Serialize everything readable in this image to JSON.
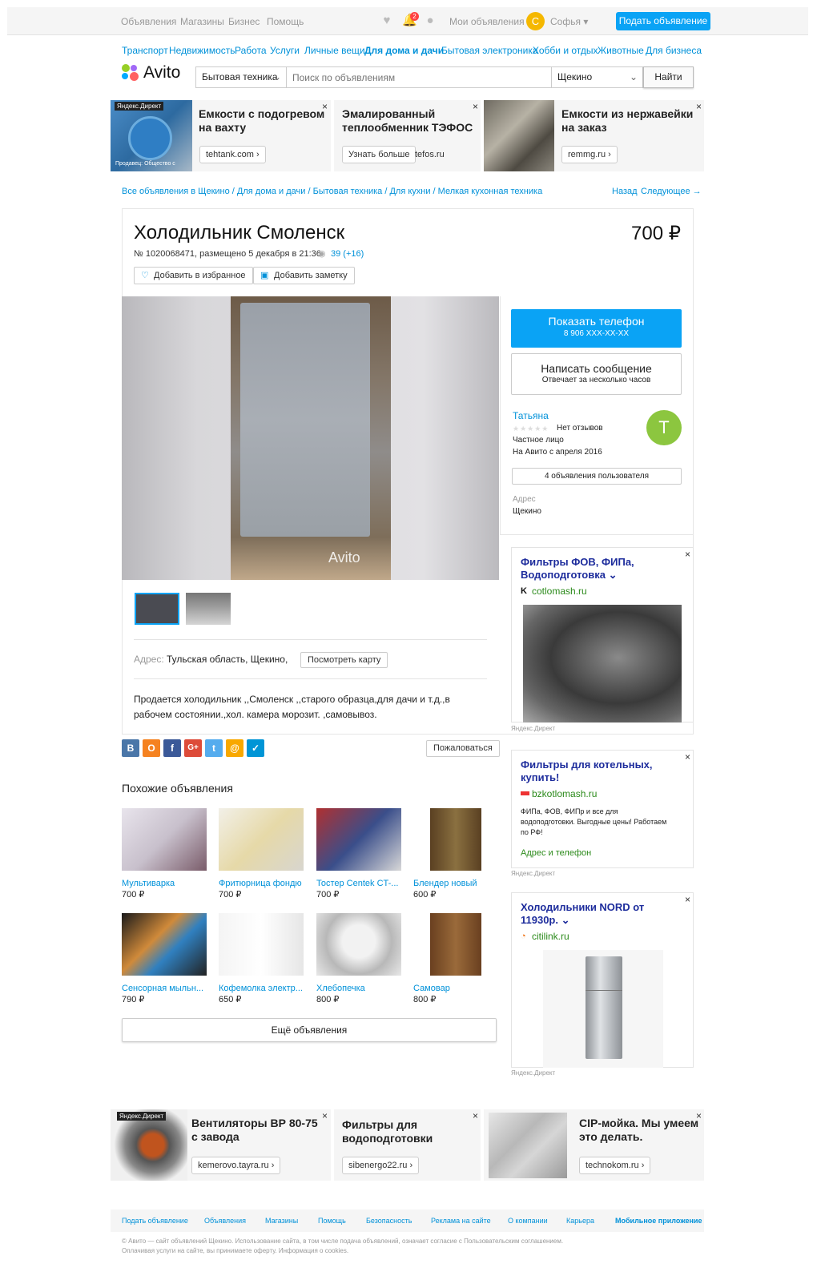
{
  "topbar": {
    "links": [
      "Объявления",
      "Магазины",
      "Бизнес",
      "Помощь"
    ],
    "notif_count": "2",
    "my_ads": "Мои объявления",
    "avatar_letter": "С",
    "user": "Софья",
    "post_ad": "Подать объявление"
  },
  "categories": [
    "Транспорт",
    "Недвижимость",
    "Работа",
    "Услуги",
    "Личные вещи",
    "Для дома и дачи",
    "Бытовая электроника",
    "Хобби и отдых",
    "Животные",
    "Для бизнеса"
  ],
  "logo": "Avito",
  "search": {
    "category": "Бытовая техника",
    "placeholder": "Поиск по объявлениям",
    "city": "Щекино",
    "button": "Найти"
  },
  "top_ads": [
    {
      "badge": "Яндекс.Директ",
      "caption": "Продавец: Общество с",
      "title": "Емкости с подогревом на вахту",
      "button": "tehtank.com ›"
    },
    {
      "title": "Эмалированный теплообменник ТЭФОС",
      "button": "Узнать больше",
      "domain": "tefos.ru"
    },
    {
      "title": "Емкости из нержавейки на заказ",
      "button": "remmg.ru ›"
    }
  ],
  "breadcrumbs": "Все объявления в Щекино / Для дома и дачи / Бытовая техника / Для кухни / Мелкая кухонная техника",
  "nav": {
    "back": "Назад",
    "next": "Следующее →"
  },
  "item": {
    "title": "Холодильник Смоленск",
    "price": "700 ₽",
    "meta": "№ 1020068471, размещено 5 декабря в 21:36",
    "views": "39 (+16)",
    "fav": "Добавить в избранное",
    "note": "Добавить заметку",
    "watermark": "Avito",
    "address_label": "Адрес:",
    "address": "Тульская область, Щекино,",
    "map_btn": "Посмотреть карту",
    "description": "Продается холодильник ,,Смоленск ,,старого образца,для дачи и т.д.,в рабочем состоянии.,хол. камера морозит. ,самовывоз.",
    "complain": "Пожаловаться"
  },
  "seller": {
    "phone_btn": "Показать телефон",
    "phone": "8 906 XXX-XX-XX",
    "msg_btn": "Написать сообщение",
    "msg_sub": "Отвечает за несколько часов",
    "name": "Татьяна",
    "reviews": "Нет отзывов",
    "type": "Частное лицо",
    "since": "На Авито с апреля 2016",
    "avatar": "Т",
    "ads_count": "4 объявления пользователя",
    "addr_label": "Адрес",
    "addr": "Щекино"
  },
  "social": [
    "В",
    "О",
    "f",
    "G+",
    "t",
    "@",
    "✓"
  ],
  "similar_title": "Похожие объявления",
  "similar": [
    {
      "title": "Мультиварка",
      "price": "700 ₽"
    },
    {
      "title": "Фритюрница фондю",
      "price": "700 ₽"
    },
    {
      "title": "Тостер Centek CT-...",
      "price": "700 ₽"
    },
    {
      "title": "Блендер новый",
      "price": "600 ₽"
    },
    {
      "title": "Сенсорная мыльн...",
      "price": "790 ₽"
    },
    {
      "title": "Кофемолка электр...",
      "price": "650 ₽"
    },
    {
      "title": "Хлебопечка",
      "price": "800 ₽"
    },
    {
      "title": "Самовар",
      "price": "800 ₽"
    }
  ],
  "more_btn": "Ещё объявления",
  "right_ads": [
    {
      "title": "Фильтры ФОВ, ФИПа, Водоподготовка",
      "domain": "cotlomash.ru",
      "label": "Яндекс.Директ"
    },
    {
      "title": "Фильтры для котельных, купить!",
      "domain": "bzkotlomash.ru",
      "text": "ФИПа, ФОВ, ФИПр и все для водоподготовки. Выгодные цены! Работаем по РФ!",
      "link": "Адрес и телефон",
      "label": "Яндекс.Директ"
    },
    {
      "title": "Холодильники NORD от 11930р.",
      "domain": "citilink.ru",
      "label": "Яндекс.Директ"
    }
  ],
  "bottom_ads": [
    {
      "badge": "Яндекс.Директ",
      "title": "Вентиляторы ВР 80-75 с завода",
      "button": "kemerovo.tayra.ru ›"
    },
    {
      "title": "Фильтры для водоподготовки",
      "button": "sibenergo22.ru ›"
    },
    {
      "title": "CIP-мойка. Мы умеем это делать.",
      "button": "technokom.ru ›"
    }
  ],
  "footer": {
    "links": [
      "Подать объявление",
      "Объявления",
      "Магазины",
      "Помощь",
      "Безопасность",
      "Реклама на сайте",
      "О компании",
      "Карьера",
      "Мобильное приложение"
    ],
    "line1": "© Авито — сайт объявлений Щекино. Использование сайта, в том числе подача объявлений, означает согласие с Пользовательским соглашением.",
    "line2": "Оплачивая услуги на сайте, вы принимаете оферту. Информация о cookies."
  },
  "colors": {
    "link": "#0091d9",
    "accent": "#0aa3f5",
    "avatar": "#8cc63f"
  }
}
